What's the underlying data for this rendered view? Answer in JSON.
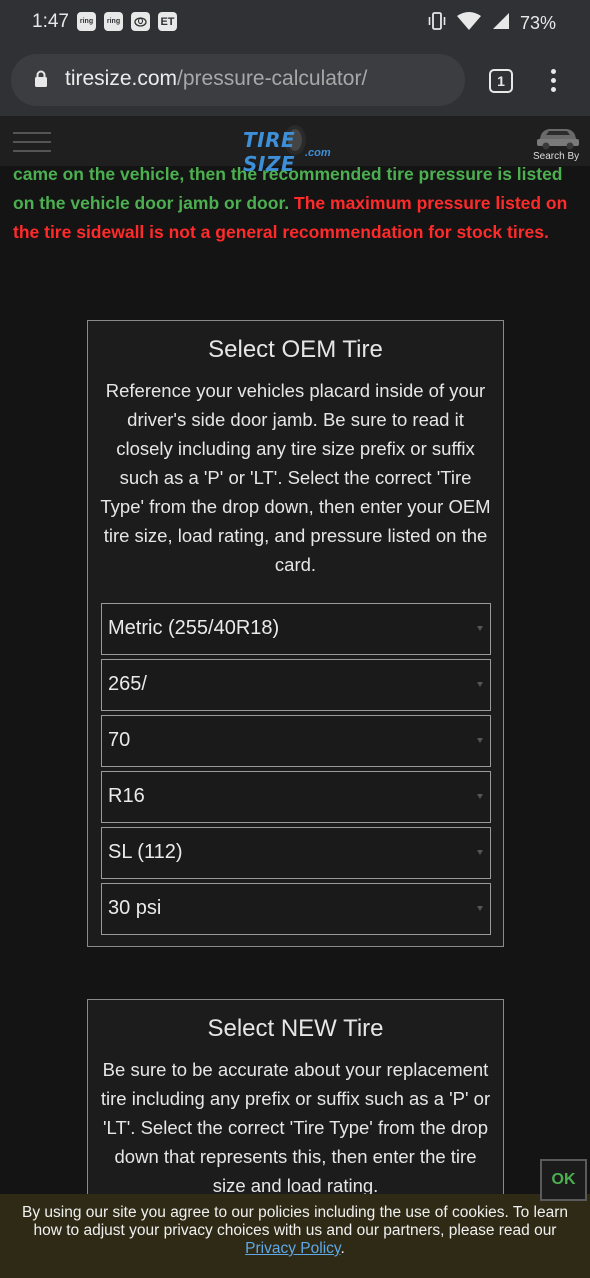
{
  "status_bar": {
    "time": "1:47",
    "notifications": [
      "ring",
      "ring",
      "toyota-icon",
      "ET"
    ],
    "battery": "73%"
  },
  "browser": {
    "url_host": "tiresize.com",
    "url_path": "/pressure-calculator/",
    "tab_count": "1"
  },
  "header": {
    "logo_main": "TIRE SIZE",
    "logo_sub": ".com",
    "search_by": "Search By"
  },
  "notice": {
    "green_text": "came on the vehicle, then the recommended tire pressure is listed on the vehicle door jamb or door.",
    "red_text": "The maximum pressure listed on the tire sidewall is not a general recommendation for stock tires."
  },
  "oem_card": {
    "title": "Select OEM Tire",
    "description": "Reference your vehicles placard inside of your driver's side door jamb. Be sure to read it closely including any tire size prefix or suffix such as a 'P' or 'LT'. Select the correct 'Tire Type' from the drop down, then enter your OEM tire size, load rating, and pressure listed on the card.",
    "selects": [
      {
        "value": "Metric (255/40R18)"
      },
      {
        "value": "265/"
      },
      {
        "value": "70"
      },
      {
        "value": "R16"
      },
      {
        "value": "SL (112)"
      },
      {
        "value": "30 psi"
      }
    ]
  },
  "new_card": {
    "title": "Select NEW Tire",
    "description": "Be sure to be accurate about your replacement tire including any prefix or suffix such as a 'P' or 'LT'. Select the correct 'Tire Type' from the drop down that represents this, then enter the tire size and load rating."
  },
  "ok_button": "OK",
  "cookie": {
    "text": "By using our site you agree to our policies including the use of cookies. To learn how to adjust your privacy choices with us and our partners, please read our",
    "link": "Privacy Policy",
    "end": "."
  },
  "colors": {
    "accent_green": "#4caf50",
    "warning_red": "#ff2a2a",
    "logo_blue": "#3d8fd8",
    "link_blue": "#5fa8e8"
  }
}
